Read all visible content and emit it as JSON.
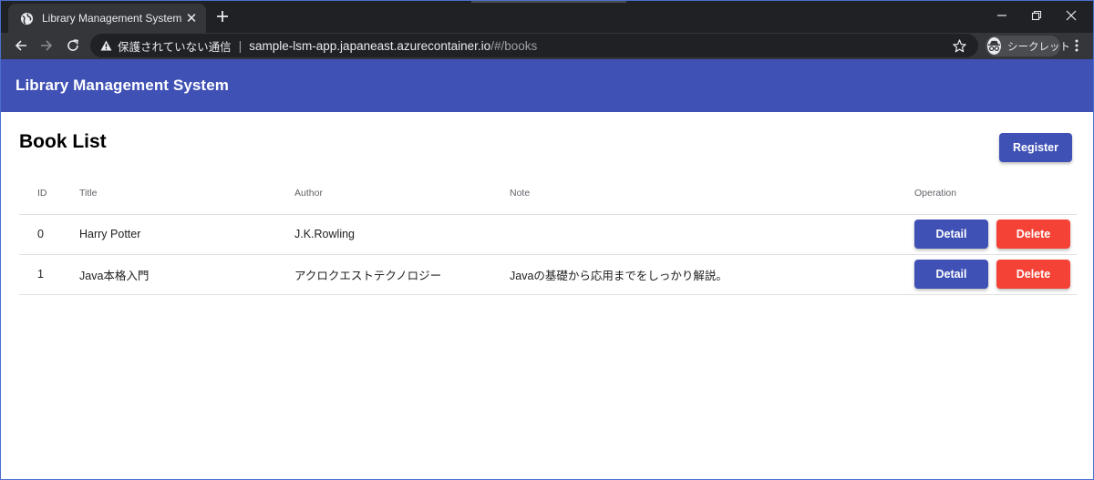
{
  "browser": {
    "tab_title": "Library Management System",
    "security_label": "保護されていない通信",
    "url_host": "sample-lsm-app.japaneast.azurecontainer.io",
    "url_path": "/#/books",
    "incognito_label": "シークレット"
  },
  "app": {
    "title": "Library Management System",
    "accent_color": "#3f51b5",
    "danger_color": "#f44336"
  },
  "page": {
    "title": "Book List",
    "register_label": "Register"
  },
  "table": {
    "headers": {
      "id": "ID",
      "title": "Title",
      "author": "Author",
      "note": "Note",
      "operation": "Operation"
    },
    "rows": [
      {
        "id": "0",
        "title": "Harry Potter",
        "author": "J.K.Rowling",
        "note": "",
        "detail_label": "Detail",
        "delete_label": "Delete"
      },
      {
        "id": "1",
        "title": "Java本格入門",
        "author": "アクロクエストテクノロジー",
        "note": "Javaの基礎から応用までをしっかり解説。",
        "detail_label": "Detail",
        "delete_label": "Delete"
      }
    ]
  }
}
